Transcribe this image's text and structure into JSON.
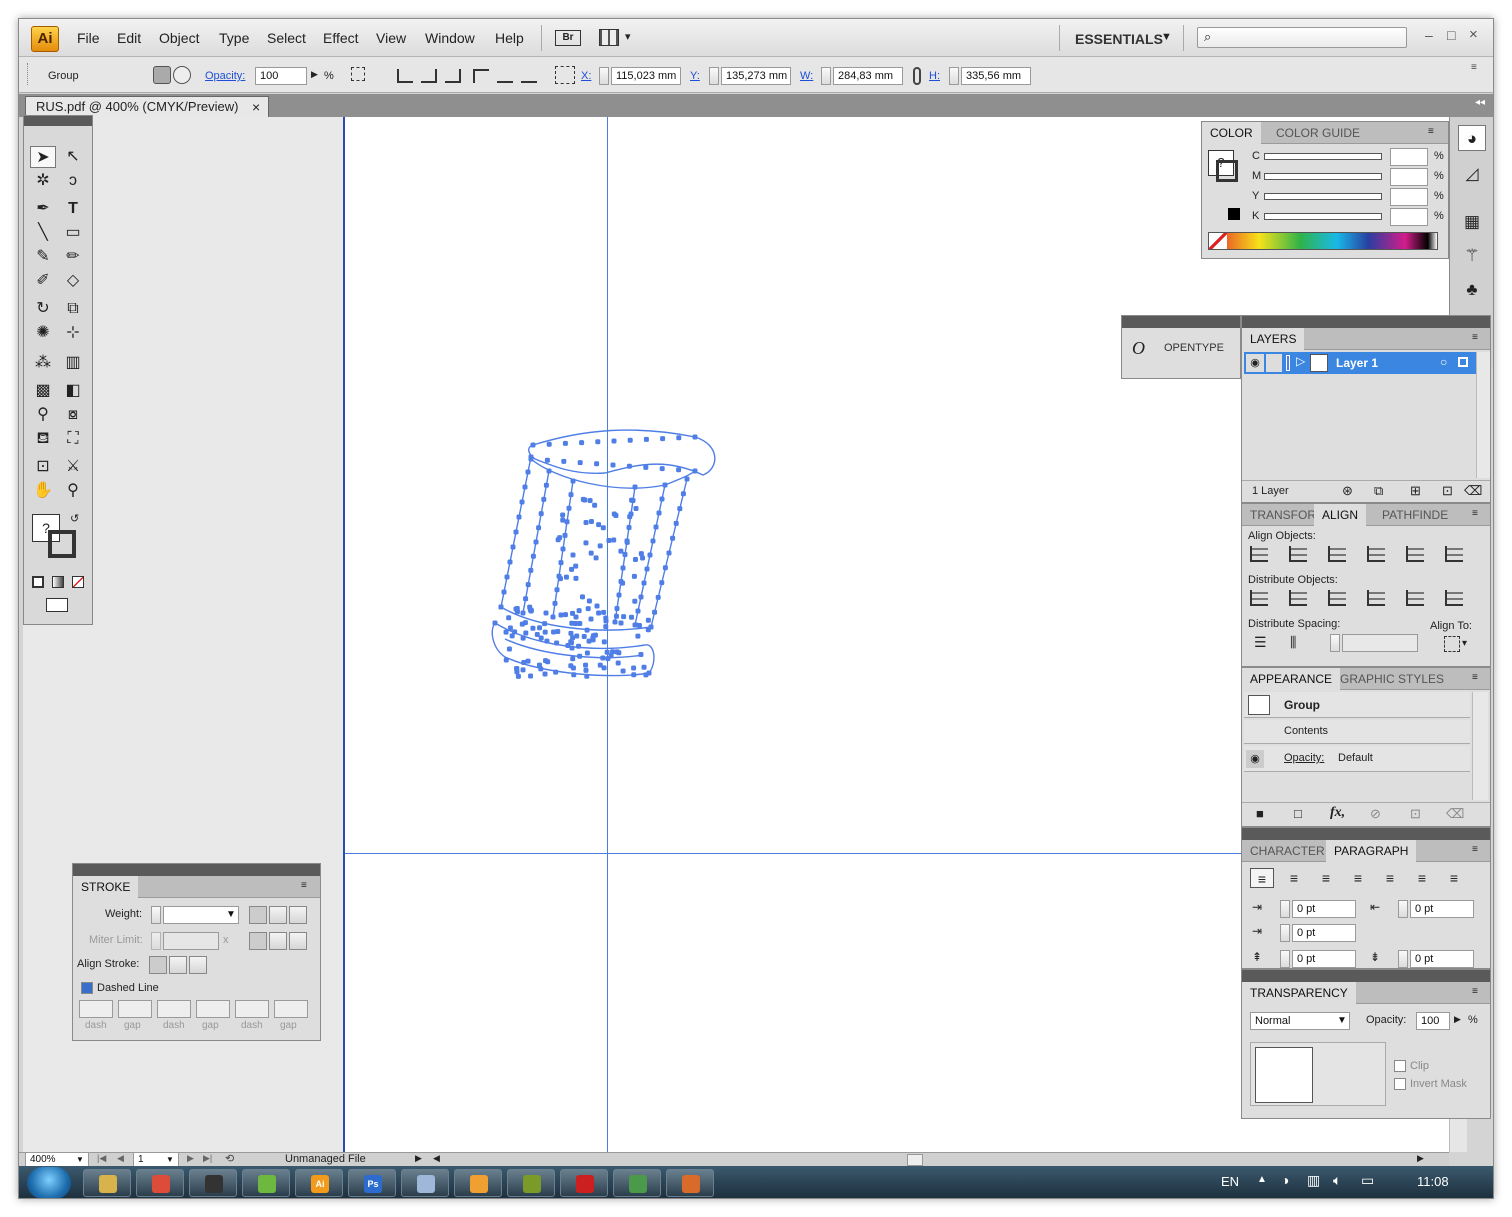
{
  "app": {
    "logo": "Ai",
    "menu": [
      "File",
      "Edit",
      "Object",
      "Type",
      "Select",
      "Effect",
      "View",
      "Window",
      "Help"
    ],
    "br_label": "Br",
    "workspace": "ESSENTIALS",
    "win_min": "–",
    "win_max": "□",
    "win_close": "×"
  },
  "control": {
    "selection": "Group",
    "opacity_label": "Opacity:",
    "opacity": "100",
    "pct": "%",
    "x_label": "X:",
    "x": "115,023 mm",
    "y_label": "Y:",
    "y": "135,273 mm",
    "w_label": "W:",
    "w": "284,83 mm",
    "h_label": "H:",
    "h": "335,56 mm"
  },
  "document": {
    "tab_title": "RUS.pdf @ 400% (CMYK/Preview)",
    "close": "×"
  },
  "color": {
    "tab_active": "COLOR",
    "tab_inactive": "COLOR GUIDE",
    "channels": [
      "C",
      "M",
      "Y",
      "K"
    ],
    "pct": "%"
  },
  "opentype": {
    "label": "OPENTYPE",
    "icon": "O"
  },
  "layers": {
    "tab": "LAYERS",
    "layer_name": "Layer 1",
    "count": "1 Layer"
  },
  "align": {
    "tabs": [
      "TRANSFOR",
      "ALIGN",
      "PATHFINDE"
    ],
    "align_objects": "Align Objects:",
    "distribute_objects": "Distribute Objects:",
    "distribute_spacing": "Distribute Spacing:",
    "align_to": "Align To:"
  },
  "appearance": {
    "tabs": [
      "APPEARANCE",
      "GRAPHIC STYLES"
    ],
    "group": "Group",
    "contents": "Contents",
    "opacity_label": "Opacity:",
    "opacity_value": "Default"
  },
  "character": {
    "tabs": [
      "CHARACTER",
      "PARAGRAPH"
    ],
    "indent_left": "0 pt",
    "indent_right": "0 pt",
    "indent_first": "0 pt",
    "space_before": "0 pt",
    "space_after": "0 pt"
  },
  "transparency": {
    "tab": "TRANSPARENCY",
    "blend": "Normal",
    "opacity_label": "Opacity:",
    "opacity": "100",
    "pct": "%",
    "clip": "Clip",
    "invert": "Invert Mask"
  },
  "stroke": {
    "tab": "STROKE",
    "weight_label": "Weight:",
    "miter_label": "Miter Limit:",
    "miter_x": "x",
    "align_label": "Align Stroke:",
    "dashed": "Dashed Line",
    "dash_labels": [
      "dash",
      "gap",
      "dash",
      "gap",
      "dash",
      "gap"
    ]
  },
  "status": {
    "zoom": "400%",
    "page": "1",
    "info": "Unmanaged File"
  },
  "taskbar": {
    "lang": "EN",
    "time": "11:08",
    "apps": [
      {
        "name": "explorer",
        "color": "#d8b24a",
        "label": ""
      },
      {
        "name": "chrome",
        "color": "#dd4b39",
        "label": ""
      },
      {
        "name": "media",
        "color": "#333333",
        "label": ""
      },
      {
        "name": "app-green",
        "color": "#6fb83f",
        "label": ""
      },
      {
        "name": "illustrator",
        "color": "#f19a1c",
        "label": "Ai"
      },
      {
        "name": "photoshop",
        "color": "#2d6ccf",
        "label": "Ps"
      },
      {
        "name": "doc",
        "color": "#9fb7d8",
        "label": ""
      },
      {
        "name": "player",
        "color": "#f0a030",
        "label": ""
      },
      {
        "name": "colors",
        "color": "#7a9a2a",
        "label": ""
      },
      {
        "name": "opera",
        "color": "#cc1f1f",
        "label": ""
      },
      {
        "name": "tool",
        "color": "#4a9a4a",
        "label": ""
      },
      {
        "name": "remote",
        "color": "#d86b2a",
        "label": ""
      }
    ]
  },
  "colors": {
    "accent": "#3a86e0",
    "path": "#4f7ee6",
    "guide": "#4a7de0"
  }
}
